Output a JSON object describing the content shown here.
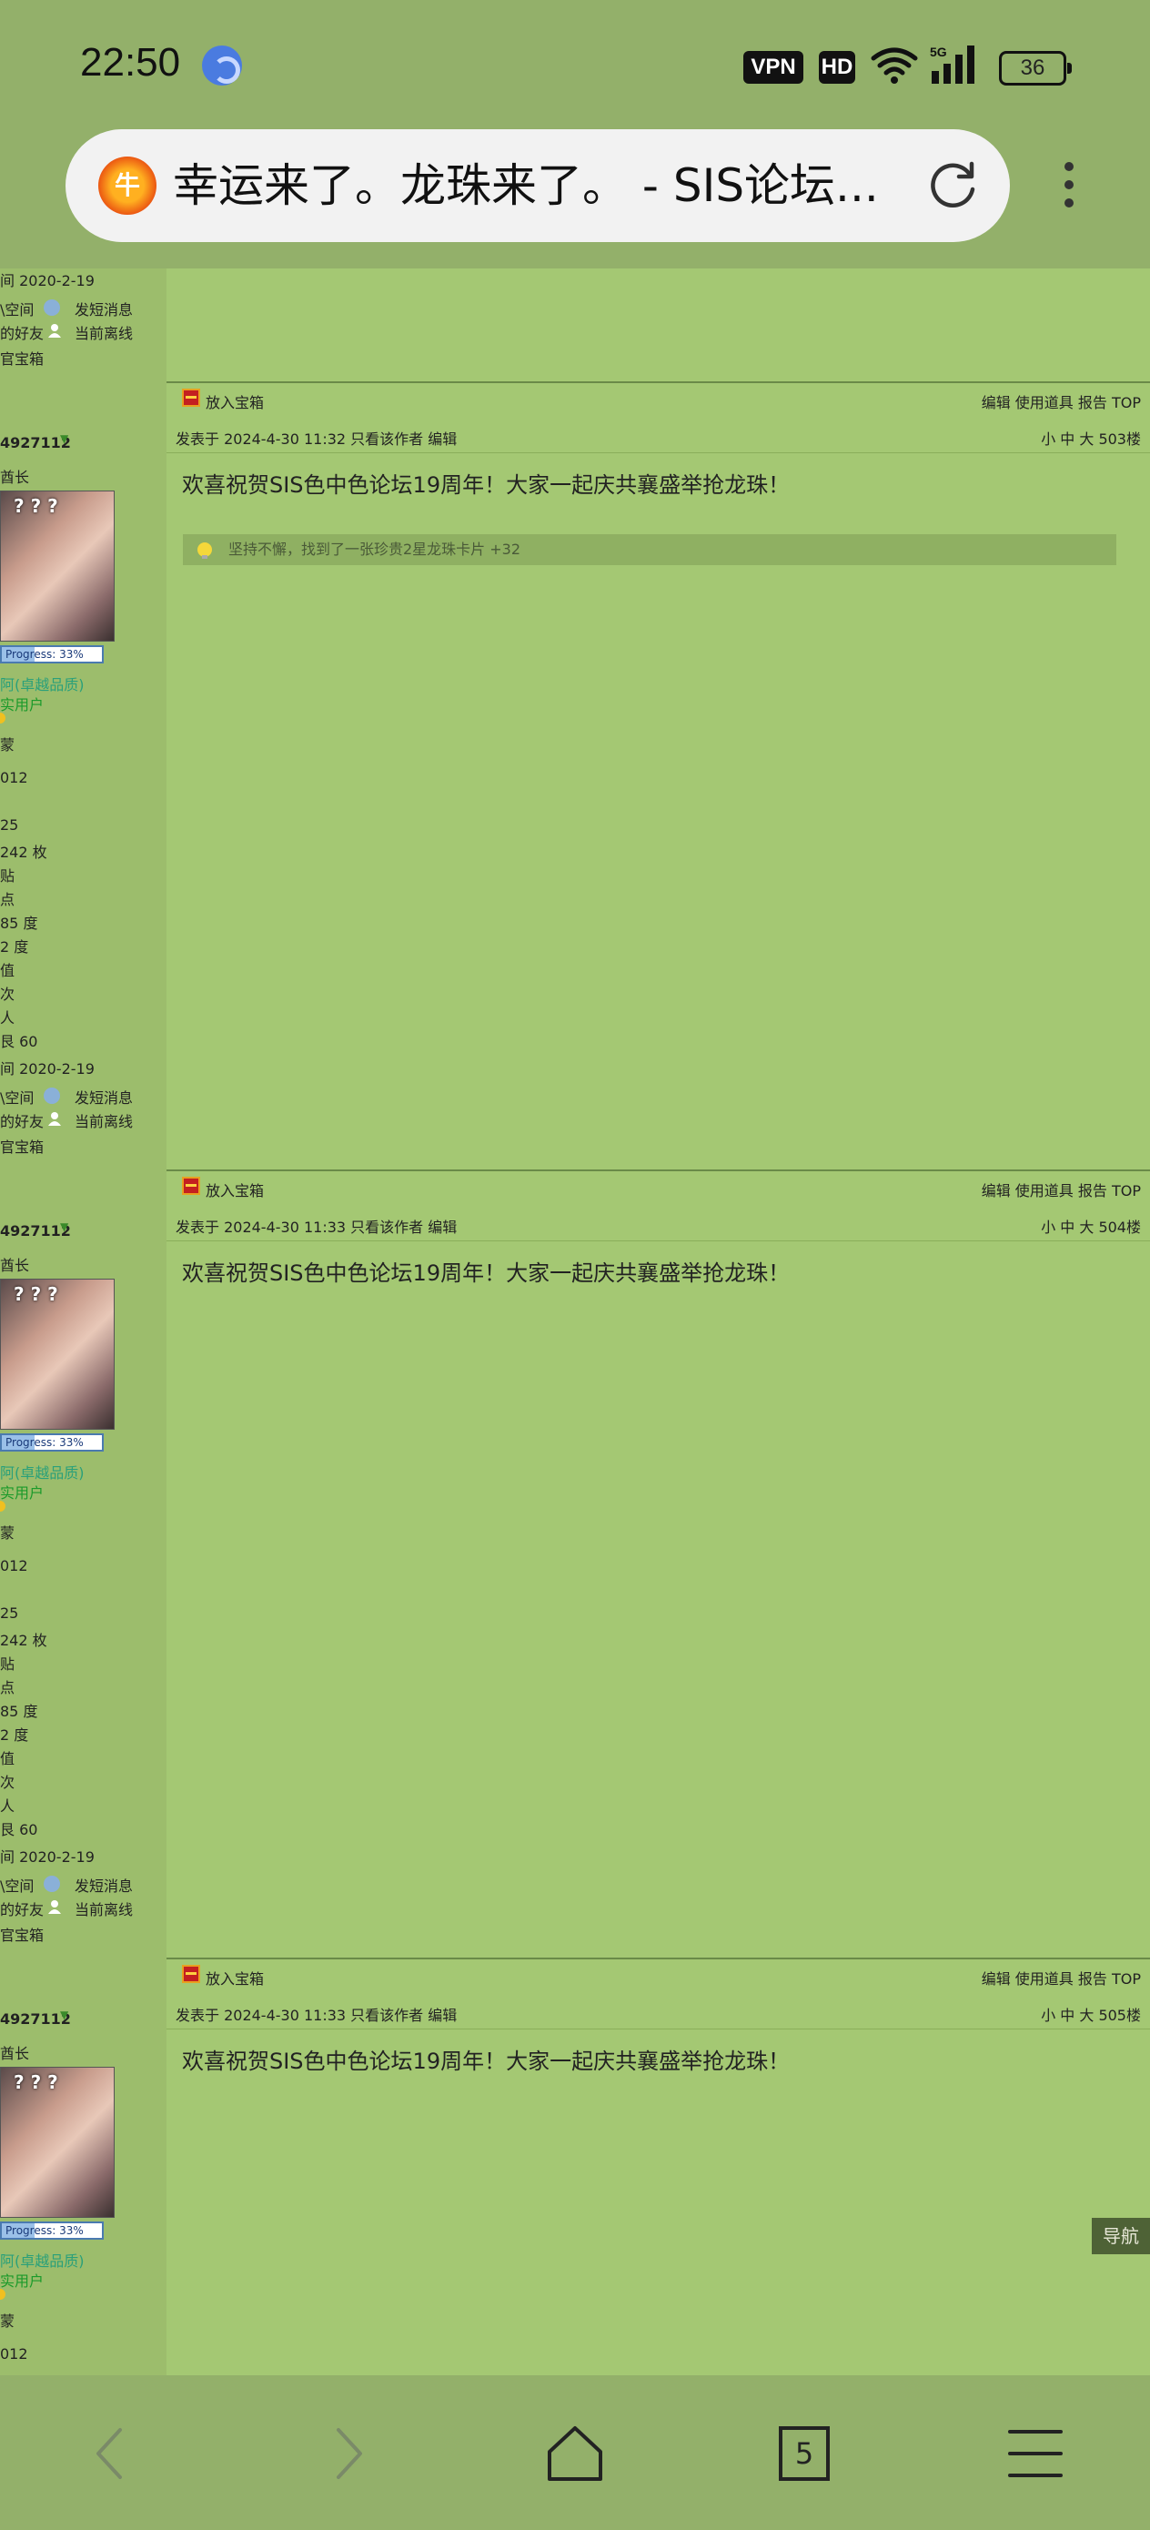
{
  "status_bar": {
    "time": "22:50",
    "vpn": "VPN",
    "hd": "HD",
    "network": "5G",
    "battery": "36"
  },
  "browser": {
    "site_icon_char": "牛",
    "page_title": "幸运来了。龙珠来了。 - SIS论坛...",
    "tab_count": "5"
  },
  "sidebar_blocks": [
    {
      "reg_date": "间  2020-2-19",
      "space": "\\空间",
      "send_msg": "发短消息",
      "friend": "的好友",
      "status": "当前离线",
      "box": "官宝箱"
    },
    {
      "username": "4927112",
      "rank": "酋长",
      "progress": "Progress:  33%",
      "medal": "阿(卓越品质)",
      "user_type": "实用户",
      "flag": "蒙",
      "uid": "012",
      "posts_no": "25",
      "coins": "242 枚",
      "posts": "贴",
      "points": "点",
      "degree1": "85 度",
      "degree2": "2 度",
      "value": "值",
      "times": "次",
      "people": "人",
      "perm": "艮  60",
      "reg_date": "间  2020-2-19",
      "space": "\\空间",
      "send_msg": "发短消息",
      "friend": "的好友",
      "status": "当前离线",
      "box": "官宝箱"
    },
    {
      "username": "4927112",
      "rank": "酋长",
      "progress": "Progress:  33%",
      "medal": "阿(卓越品质)",
      "user_type": "实用户",
      "flag": "蒙",
      "uid": "012",
      "posts_no": "25",
      "coins": "242 枚",
      "posts": "贴",
      "points": "点",
      "degree1": "85 度",
      "degree2": "2 度",
      "value": "值",
      "times": "次",
      "people": "人",
      "perm": "艮  60",
      "reg_date": "间  2020-2-19",
      "space": "\\空间",
      "send_msg": "发短消息",
      "friend": "的好友",
      "status": "当前离线",
      "box": "官宝箱"
    },
    {
      "username": "4927112",
      "rank": "酋长",
      "progress": "Progress:  33%",
      "medal": "阿(卓越品质)",
      "user_type": "实用户",
      "flag": "蒙",
      "uid": "012"
    }
  ],
  "posts": [
    {
      "put_box": "放入宝箱",
      "tools": "编辑 使用道具 报告 TOP",
      "meta": "发表于 2024-4-30 11:32  只看该作者  编辑",
      "size_floor": "小  中  大    503楼",
      "body": "欢喜祝贺SIS色中色论坛19周年！大家一起庆共襄盛举抢龙珠！",
      "rating": "坚持不懈，找到了一张珍贵2星龙珠卡片 +32"
    },
    {
      "put_box": "放入宝箱",
      "tools": "编辑 使用道具 报告 TOP",
      "meta": "发表于 2024-4-30 11:33  只看该作者  编辑",
      "size_floor": "小  中  大    504楼",
      "body": "欢喜祝贺SIS色中色论坛19周年！大家一起庆共襄盛举抢龙珠！"
    },
    {
      "put_box": "放入宝箱",
      "tools": "编辑 使用道具 报告 TOP",
      "meta": "发表于 2024-4-30 11:33  只看该作者  编辑",
      "size_floor": "小  中  大    505楼",
      "body": "欢喜祝贺SIS色中色论坛19周年！大家一起庆共襄盛举抢龙珠！"
    }
  ],
  "nav_button": "导航",
  "colors": {
    "page_bg": "#93b06a",
    "sidebar_bg": "#9cbd6c",
    "content_bg": "#a4c873",
    "rating_bg": "#8fb062",
    "nav_bg": "#4e6236"
  }
}
